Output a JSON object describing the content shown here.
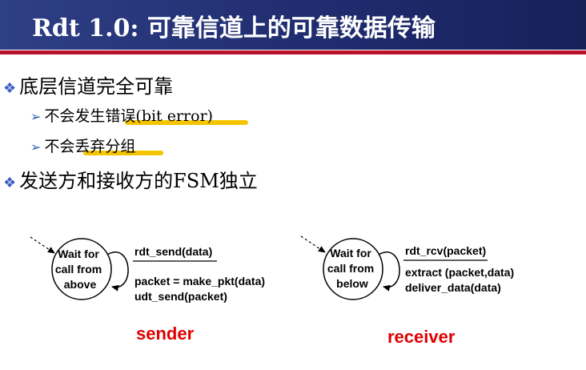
{
  "title": "Rdt 1.0: 可靠信道上的可靠数据传输",
  "bullets": {
    "b1": "底层信道完全可靠",
    "b1_sub1": "不会发生错误(bit error)",
    "b1_sub2": "不会丢弃分组",
    "b2": "发送方和接收方的FSM独立"
  },
  "sender": {
    "state": [
      "Wait for",
      "call from",
      "above"
    ],
    "event": "rdt_send(data)",
    "action1": "packet = make_pkt(data)",
    "action2": "udt_send(packet)",
    "caption": "sender"
  },
  "receiver": {
    "state": [
      "Wait for",
      "call from",
      "below"
    ],
    "event": "rdt_rcv(packet)",
    "action1": "extract (packet,data)",
    "action2": "deliver_data(data)",
    "caption": "receiver"
  },
  "colors": {
    "title_bg": "#1f2c6e",
    "rule": "#b8122a",
    "highlight": "#f5c400",
    "caption": "#e00000",
    "bullet": "#3a5cc7"
  }
}
